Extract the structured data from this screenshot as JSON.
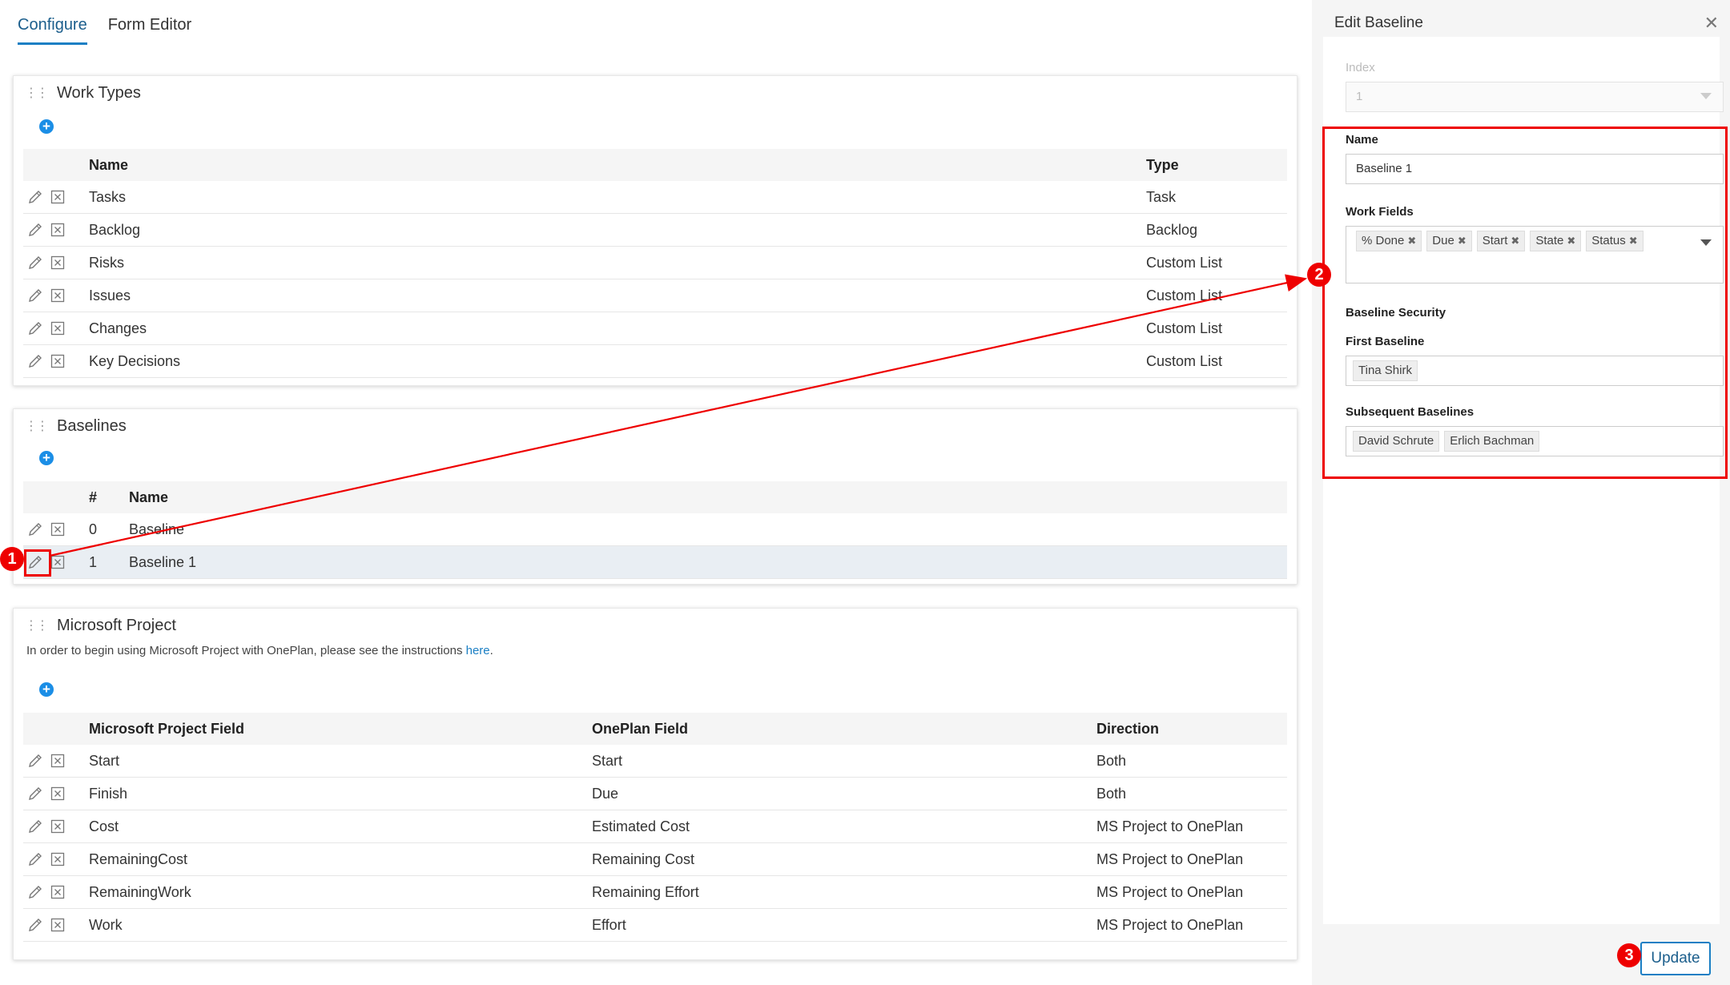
{
  "tabs": [
    {
      "label": "Configure",
      "active": true
    },
    {
      "label": "Form Editor",
      "active": false
    }
  ],
  "work_types": {
    "title": "Work Types",
    "columns": {
      "name": "Name",
      "type": "Type"
    },
    "rows": [
      {
        "name": "Tasks",
        "type": "Task"
      },
      {
        "name": "Backlog",
        "type": "Backlog"
      },
      {
        "name": "Risks",
        "type": "Custom List"
      },
      {
        "name": "Issues",
        "type": "Custom List"
      },
      {
        "name": "Changes",
        "type": "Custom List"
      },
      {
        "name": "Key Decisions",
        "type": "Custom List"
      }
    ]
  },
  "baselines": {
    "title": "Baselines",
    "columns": {
      "num": "#",
      "name": "Name"
    },
    "rows": [
      {
        "num": "0",
        "name": "Baseline"
      },
      {
        "num": "1",
        "name": "Baseline 1"
      }
    ]
  },
  "ms_project": {
    "title": "Microsoft Project",
    "description": "In order to begin using Microsoft Project with OnePlan, please see the instructions ",
    "link": "here",
    "description_end": ".",
    "columns": {
      "ms": "Microsoft Project Field",
      "op": "OnePlan Field",
      "dir": "Direction"
    },
    "rows": [
      {
        "ms": "Start",
        "op": "Start",
        "dir": "Both"
      },
      {
        "ms": "Finish",
        "op": "Due",
        "dir": "Both"
      },
      {
        "ms": "Cost",
        "op": "Estimated Cost",
        "dir": "MS Project to OnePlan"
      },
      {
        "ms": "RemainingCost",
        "op": "Remaining Cost",
        "dir": "MS Project to OnePlan"
      },
      {
        "ms": "RemainingWork",
        "op": "Remaining Effort",
        "dir": "MS Project to OnePlan"
      },
      {
        "ms": "Work",
        "op": "Effort",
        "dir": "MS Project to OnePlan"
      }
    ]
  },
  "edit_pane": {
    "title": "Edit Baseline",
    "index_label": "Index",
    "index_value": "1",
    "name_label": "Name",
    "name_value": "Baseline 1",
    "work_fields_label": "Work Fields",
    "work_fields": [
      "% Done",
      "Due",
      "Start",
      "State",
      "Status"
    ],
    "security_label": "Baseline Security",
    "first_baseline_label": "First Baseline",
    "first_baseline_users": [
      "Tina Shirk"
    ],
    "subsequent_label": "Subsequent Baselines",
    "subsequent_users": [
      "David Schrute",
      "Erlich Bachman"
    ],
    "update_label": "Update"
  },
  "annotations": {
    "badge1": "1",
    "badge2": "2",
    "badge3": "3",
    "color": "#e00000"
  },
  "colors": {
    "accent": "#1b7fc4",
    "add_button": "#1b8ee6"
  }
}
